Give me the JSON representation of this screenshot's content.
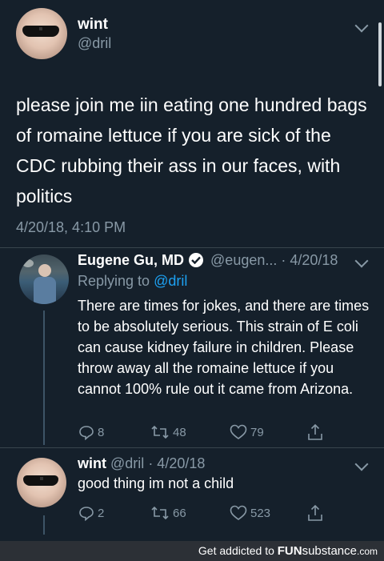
{
  "main_tweet": {
    "display_name": "wint",
    "handle": "@dril",
    "text": "please join me iin eating one hundred bags of romaine lettuce if you are sick of the CDC rubbing their ass in our faces, with politics",
    "timestamp": "4/20/18, 4:10 PM"
  },
  "reply_1": {
    "display_name": "Eugene Gu, MD",
    "handle": "@eugen...",
    "date": "· 4/20/18",
    "replying_prefix": "Replying to",
    "replying_to": "@dril",
    "text": "There are times for jokes, and there are times to be absolutely serious. This strain of E coli can cause kidney failure in children. Please throw away all the romaine lettuce if you cannot 100% rule out it came from Arizona.",
    "replies": "8",
    "retweets": "48",
    "likes": "79"
  },
  "reply_2": {
    "display_name": "wint",
    "handle": "@dril",
    "date": "· 4/20/18",
    "text": "good thing im not a child",
    "replies": "2",
    "retweets": "66",
    "likes": "523"
  },
  "footer": {
    "prefix": "Get addicted to",
    "brand_left": "FUN",
    "brand_right": "substance",
    "domain": ".com"
  },
  "colors": {
    "background": "#15202b",
    "muted": "#8899a6",
    "link": "#1da1f2",
    "footer_bg": "#2c3036"
  }
}
